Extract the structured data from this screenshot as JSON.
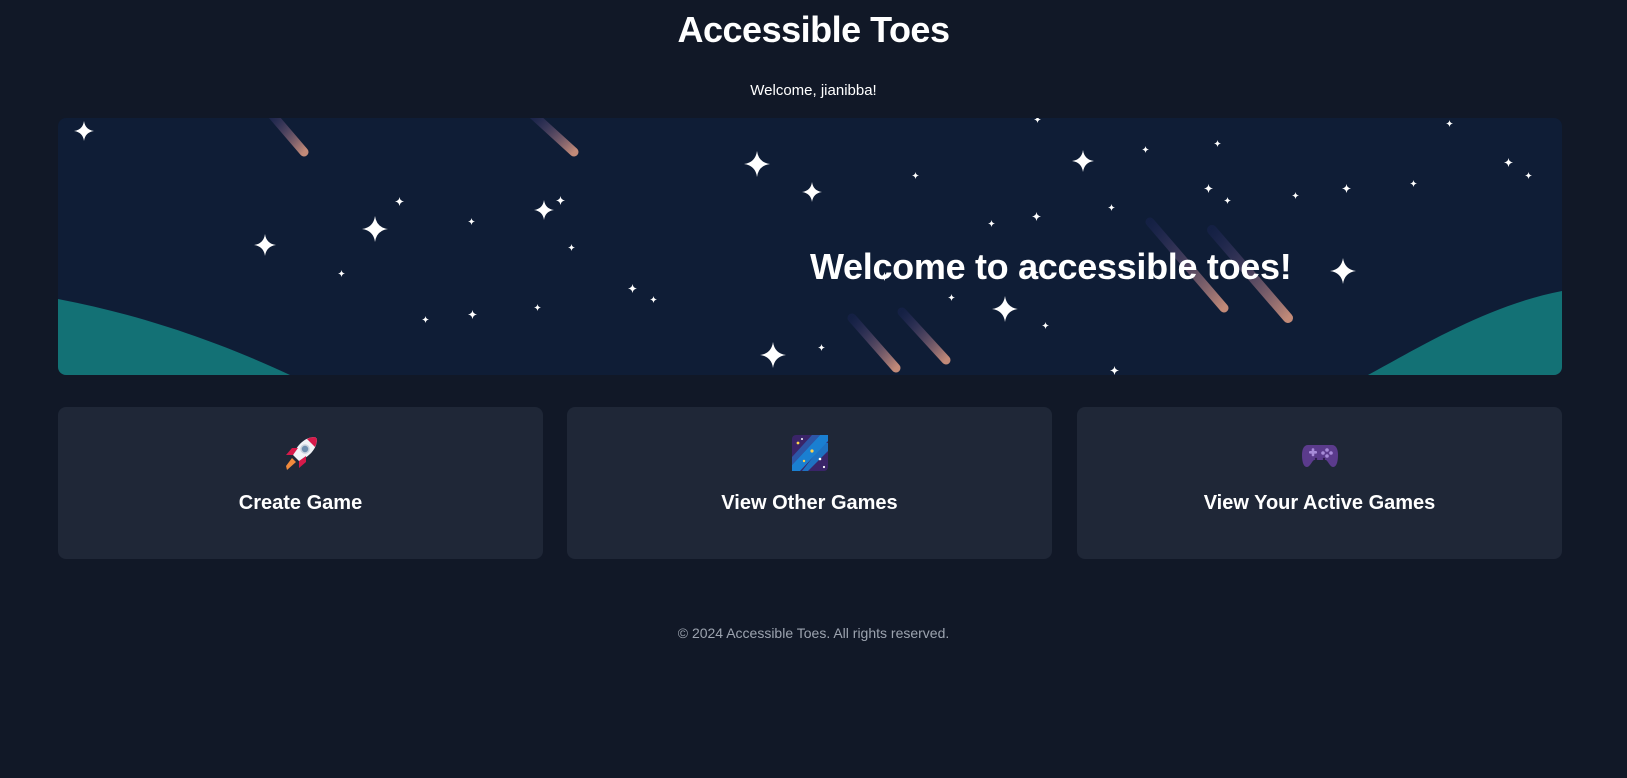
{
  "header": {
    "title": "Accessible Toes",
    "welcome_text": "Welcome, jianibba!"
  },
  "hero": {
    "heading": "Welcome to accessible toes!",
    "colors": {
      "background": "#0f1d36",
      "hill": "#137175"
    }
  },
  "actions": [
    {
      "label": "Create Game",
      "icon": "rocket-icon"
    },
    {
      "label": "View Other Games",
      "icon": "milky-way-icon"
    },
    {
      "label": "View Your Active Games",
      "icon": "game-controller-icon"
    }
  ],
  "footer": {
    "text": "© 2024 Accessible Toes. All rights reserved."
  },
  "colors": {
    "page_background": "#111827",
    "card_background": "#1f2737",
    "footer_text": "#9ca3af"
  }
}
